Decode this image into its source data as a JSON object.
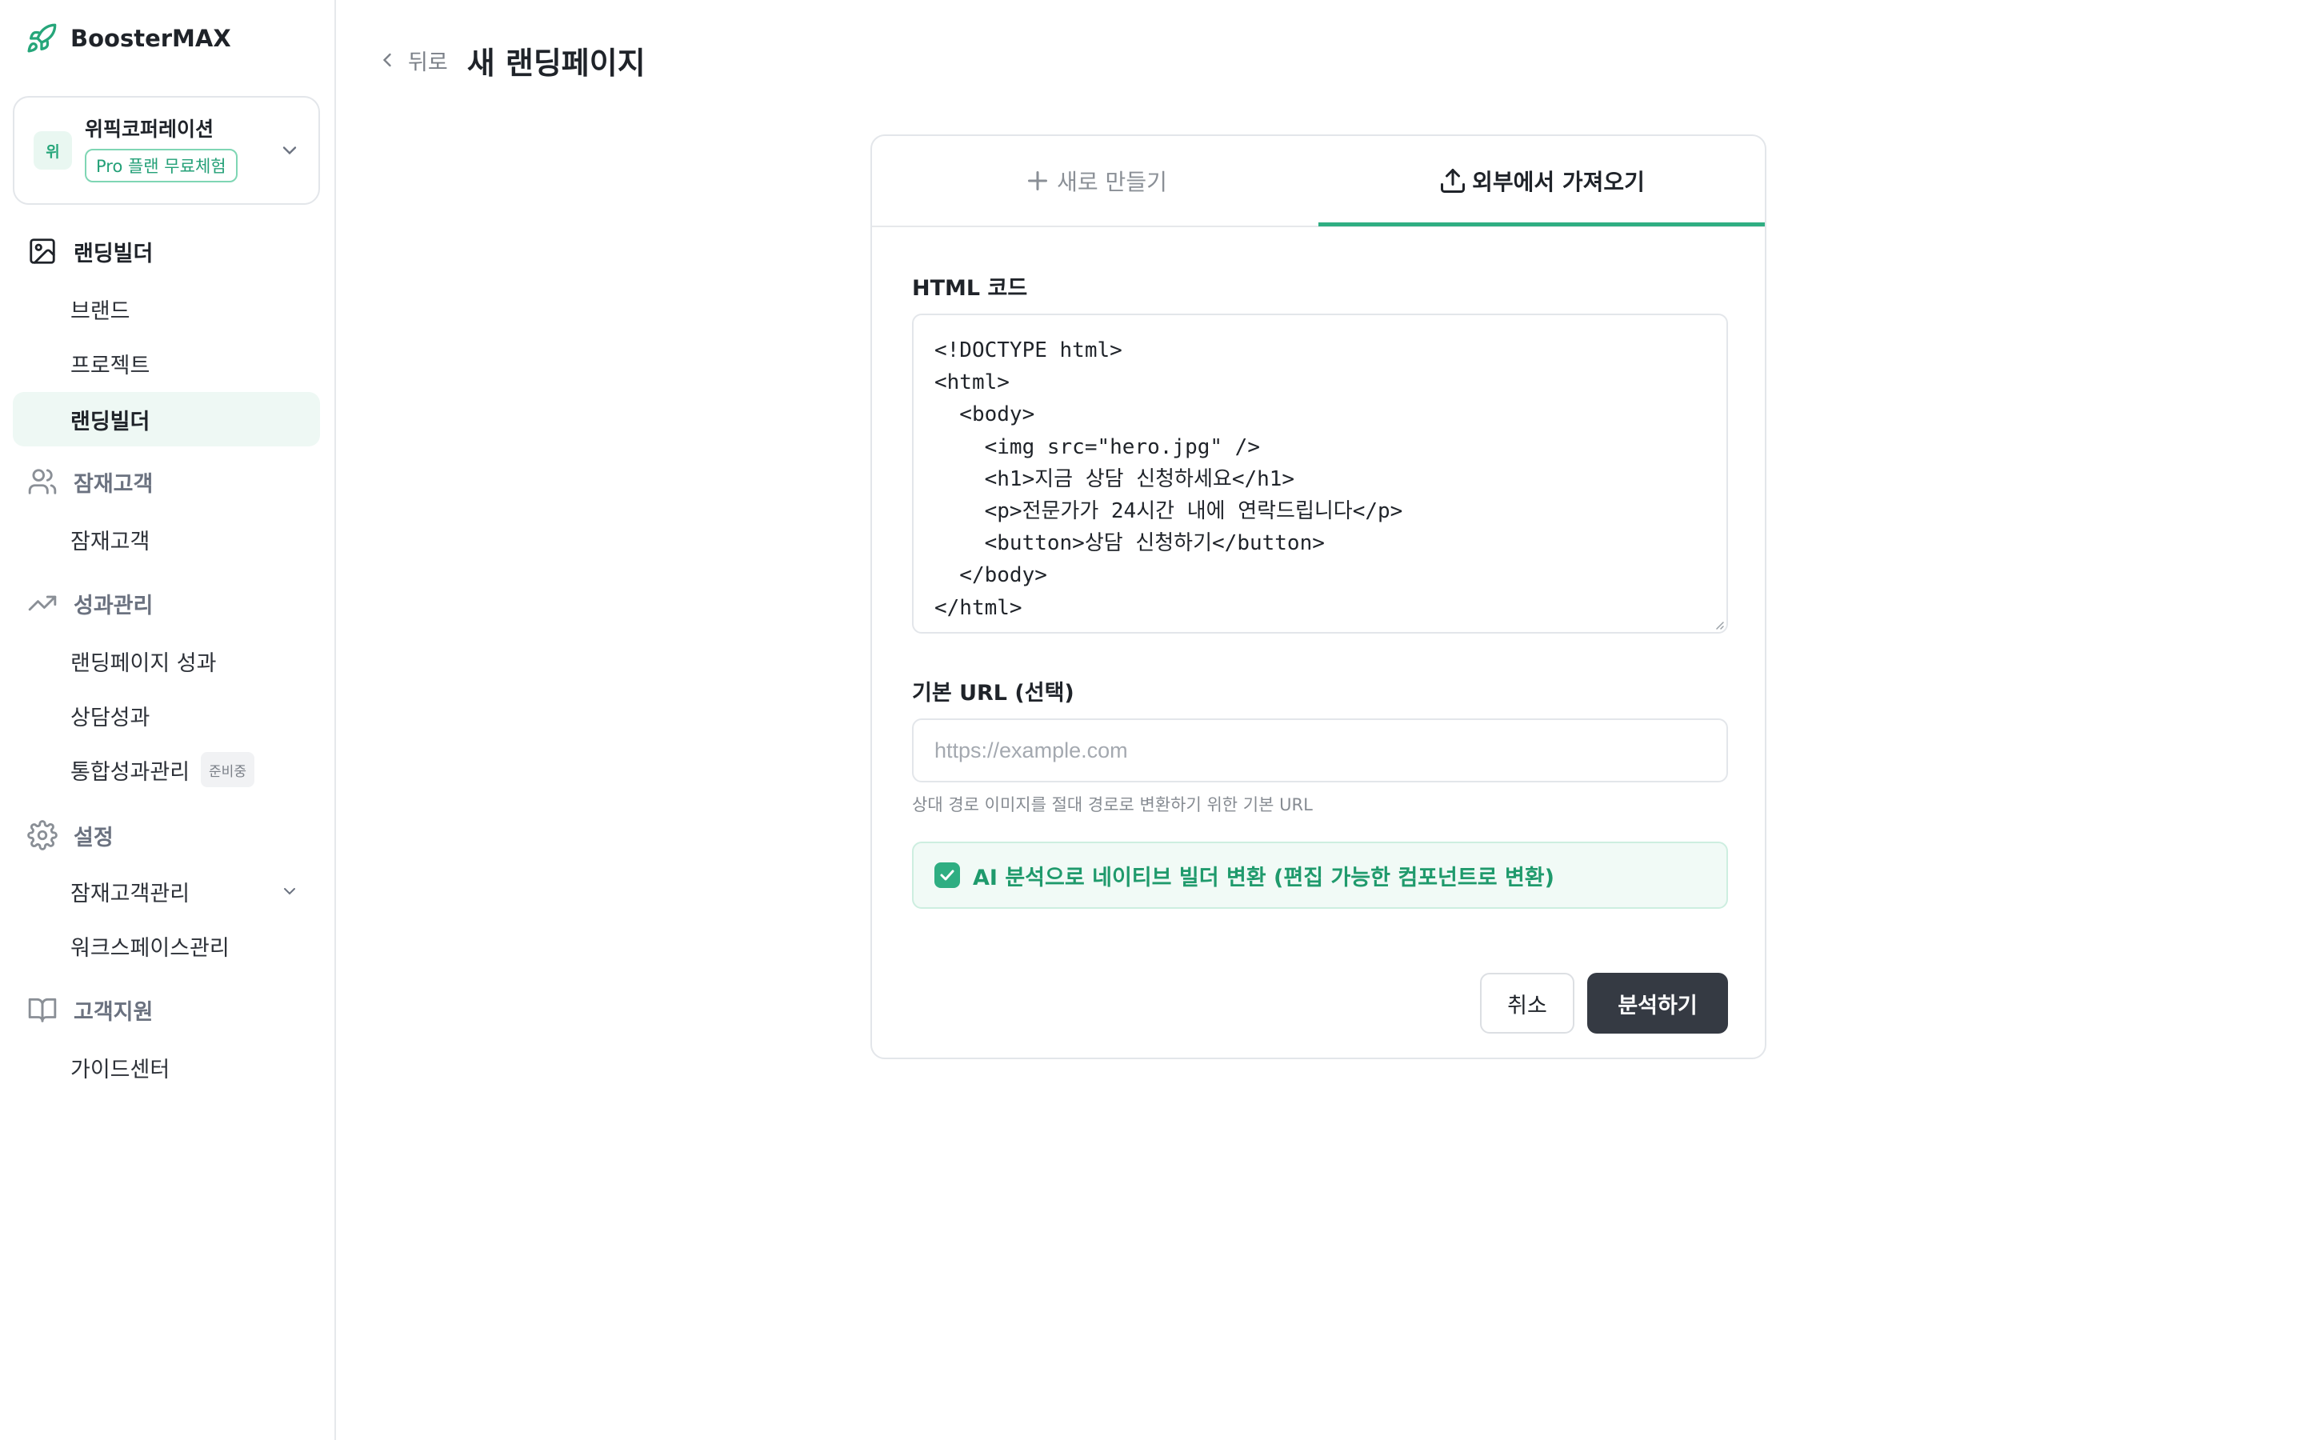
{
  "app": {
    "name": "BoosterMAX"
  },
  "workspace": {
    "avatar_text": "위",
    "name": "위픽코퍼레이션",
    "plan_badge": "Pro 플랜 무료체험"
  },
  "sidebar": {
    "sections": [
      {
        "label": "랜딩빌더",
        "icon": "image-icon",
        "items": [
          "브랜드",
          "프로젝트",
          "랜딩빌더"
        ]
      },
      {
        "label": "잠재고객",
        "icon": "users-icon",
        "items": [
          "잠재고객"
        ]
      },
      {
        "label": "성과관리",
        "icon": "trending-up-icon",
        "items": [
          "랜딩페이지 성과",
          "상담성과",
          "통합성과관리"
        ]
      },
      {
        "label": "설정",
        "icon": "gear-icon",
        "items": [
          "잠재고객관리",
          "워크스페이스관리"
        ]
      },
      {
        "label": "고객지원",
        "icon": "book-icon",
        "items": [
          "가이드센터"
        ]
      }
    ],
    "active_item": "랜딩빌더",
    "soon_badge": "준비중"
  },
  "header": {
    "back_label": "뒤로",
    "title": "새 랜딩페이지"
  },
  "tabs": [
    {
      "label": "새로 만들기",
      "icon": "plus-icon",
      "active": false
    },
    {
      "label": "외부에서 가져오기",
      "icon": "upload-icon",
      "active": true
    }
  ],
  "form": {
    "html_label": "HTML 코드",
    "html_value": "<!DOCTYPE html>\n<html>\n  <body>\n    <img src=\"hero.jpg\" />\n    <h1>지금 상담 신청하세요</h1>\n    <p>전문가가 24시간 내에 연락드립니다</p>\n    <button>상담 신청하기</button>\n  </body>\n</html>",
    "url_label": "기본 URL (선택)",
    "url_placeholder": "https://example.com",
    "url_value": "",
    "url_helper": "상대 경로 이미지를 절대 경로로 변환하기 위한 기본 URL",
    "ai_convert_label": "AI 분석으로 네이티브 빌더 변환 (편집 가능한 컴포넌트로 변환)",
    "ai_convert_checked": true,
    "cancel_label": "취소",
    "submit_label": "분석하기"
  },
  "colors": {
    "accent": "#2fae82",
    "primary_button": "#353a43",
    "active_nav_bg": "#eef8f4"
  }
}
